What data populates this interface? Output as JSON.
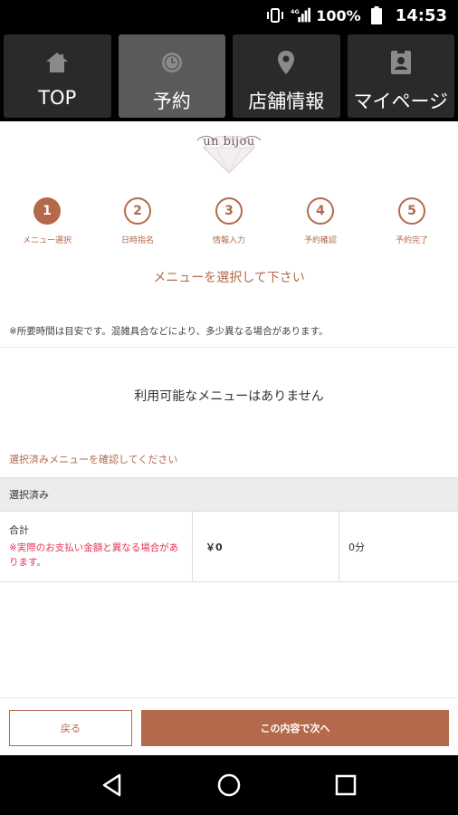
{
  "status_bar": {
    "network": "4G",
    "battery": "100%",
    "time": "14:53"
  },
  "nav": {
    "items": [
      {
        "label": "TOP",
        "icon": "home-icon"
      },
      {
        "label": "予約",
        "icon": "clock-icon"
      },
      {
        "label": "店舗情報",
        "icon": "location-pin-icon"
      },
      {
        "label": "マイページ",
        "icon": "id-card-icon"
      }
    ],
    "active_index": 1
  },
  "logo": {
    "text": "un bijou"
  },
  "steps": [
    {
      "number": "1",
      "label": "メニュー選択"
    },
    {
      "number": "2",
      "label": "日時指名"
    },
    {
      "number": "3",
      "label": "情報入力"
    },
    {
      "number": "4",
      "label": "予約確認"
    },
    {
      "number": "5",
      "label": "予約完了"
    }
  ],
  "current_step": 1,
  "instruction": "メニューを選択して下さい",
  "note": "※所要時間は目安です。混雑具合などにより、多少異なる場合があります。",
  "empty_message": "利用可能なメニューはありません",
  "confirm_title": "選択済みメニューを確認してください",
  "selected": {
    "header": "選択済み",
    "total_label": "合計",
    "total_note": "※実際のお支払い金額と異なる場合があります。",
    "price": "￥0",
    "duration": "0分"
  },
  "actions": {
    "back_label": "戻る",
    "next_label": "この内容で次へ"
  },
  "colors": {
    "accent": "#b4694a",
    "warning": "#e8315b",
    "nav_bg": "#2a2a2a",
    "nav_active_bg": "#5a5a5a"
  }
}
